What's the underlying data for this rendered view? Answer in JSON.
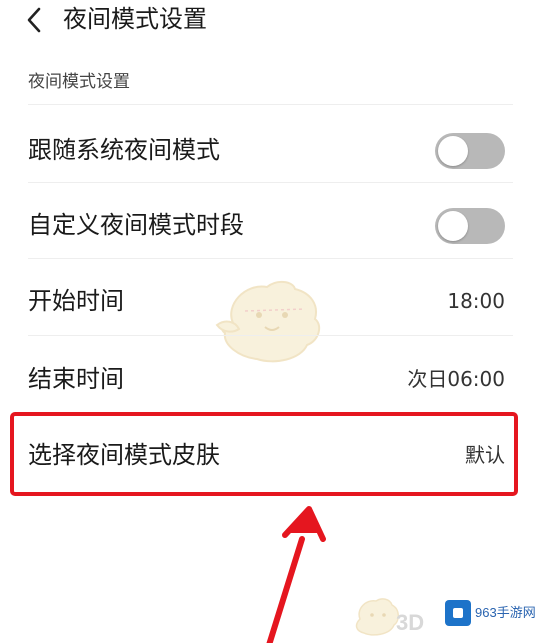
{
  "header": {
    "title": "夜间模式设置"
  },
  "section": {
    "label": "夜间模式设置"
  },
  "rows": {
    "follow_system": {
      "label": "跟随系统夜间模式",
      "enabled": false
    },
    "custom_period": {
      "label": "自定义夜间模式时段",
      "enabled": false
    },
    "start_time": {
      "label": "开始时间",
      "value": "18:00"
    },
    "end_time": {
      "label": "结束时间",
      "value": "次日06:00"
    },
    "skin": {
      "label": "选择夜间模式皮肤",
      "value": "默认"
    }
  },
  "colors": {
    "highlight": "#e5161f",
    "toggle_off": "#b8b8b8"
  },
  "watermarks": {
    "brand_3d": "3D",
    "site": "963手游网"
  }
}
